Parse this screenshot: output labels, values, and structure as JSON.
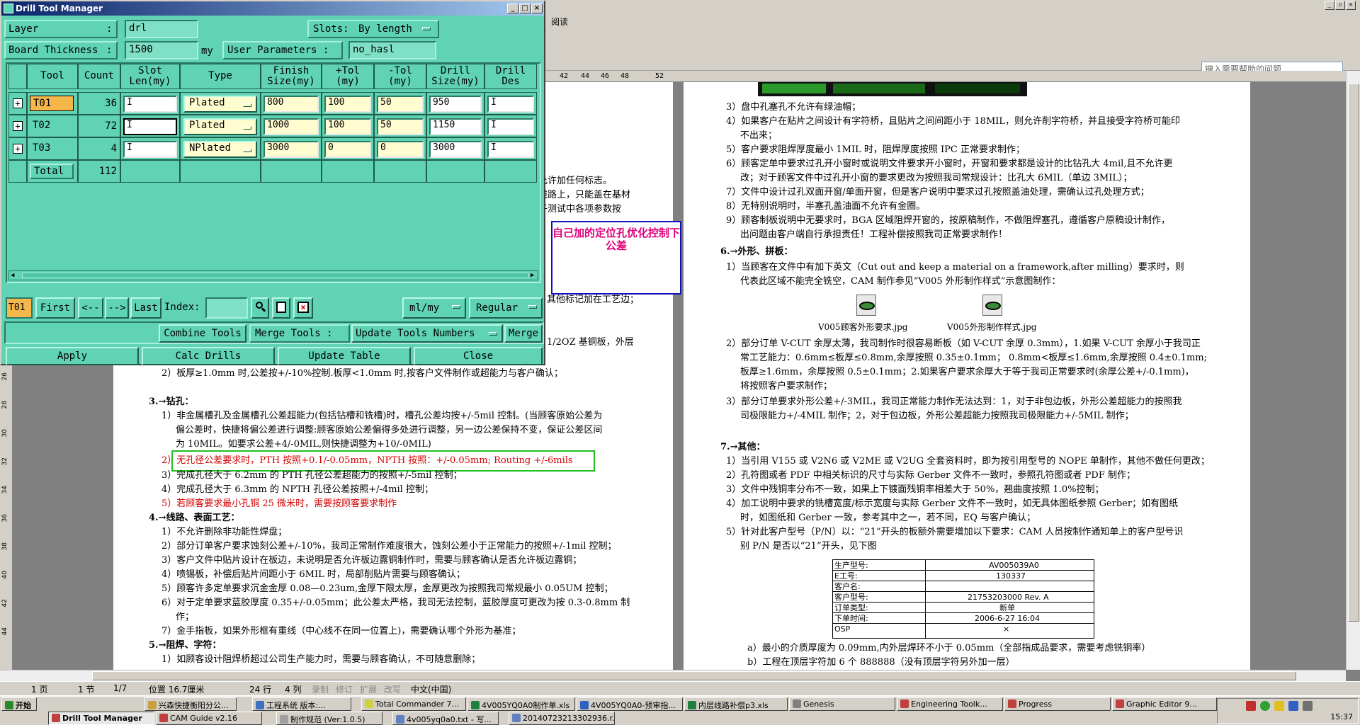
{
  "dtm": {
    "title": "Drill Tool Manager",
    "layer_label": "Layer",
    "layer_sep": ":",
    "layer_value": "drl",
    "slots_label": "Slots:",
    "slots_value": "By length",
    "board_thickness_label": "Board Thickness",
    "board_thickness_sep": ":",
    "board_thickness_value": "1500",
    "board_thickness_unit": "my",
    "user_params_label": "User Parameters :",
    "user_params_value": "no_hasl",
    "columns": [
      "Tool",
      "Count",
      "Slot Len(my)",
      "Type",
      "Finish Size(my)",
      "+Tol (my)",
      "-Tol (my)",
      "Drill Size(my)",
      "Drill Des"
    ],
    "rows": [
      {
        "tool": "T01",
        "count": "36",
        "slot_len": "",
        "type": "Plated",
        "finish": "800",
        "ptol": "100",
        "ntol": "50",
        "drill": "950",
        "des": ""
      },
      {
        "tool": "T02",
        "count": "72",
        "slot_len": "",
        "type": "Plated",
        "finish": "1000",
        "ptol": "100",
        "ntol": "50",
        "drill": "1150",
        "des": ""
      },
      {
        "tool": "T03",
        "count": "4",
        "slot_len": "",
        "type": "NPlated",
        "finish": "3000",
        "ptol": "0",
        "ntol": "0",
        "drill": "3000",
        "des": ""
      }
    ],
    "total_label": "Total",
    "total_count": "112",
    "current_tool": "T01",
    "nav": {
      "first": "First",
      "prev": "<--",
      "next": "-->",
      "last": "Last",
      "index_label": "Index:",
      "index_value": "",
      "unit": "ml/my",
      "mode": "Regular"
    },
    "actions": {
      "combine": "Combine Tools",
      "merge": "Merge Tools :",
      "update_numbers": "Update Tools Numbers",
      "merge_btn": "Merge"
    },
    "bottom": {
      "apply": "Apply",
      "calc": "Calc Drills",
      "update": "Update Table",
      "close": "Close"
    }
  },
  "annotation": "自己加的定位孔优化控制下公差",
  "word": {
    "help_placeholder": "键入需要帮助的问题",
    "toolbar_read": "阅读",
    "ruler_ticks": [
      "42",
      "44",
      "46",
      "48",
      "52"
    ],
    "left_ruler_ticks": [
      "26",
      "28",
      "30",
      "32",
      "34",
      "36",
      "38",
      "40",
      "42",
      "44"
    ],
    "status": {
      "page": "1 页",
      "section": "1 节",
      "pages": "1/7",
      "pos": "位置 16.7厘米",
      "line": "24 行",
      "col": "4 列",
      "rec": "录制",
      "trk": "修订",
      "ext": "扩展",
      "ovr": "改写",
      "lang": "中文(中国)"
    }
  },
  "left_page": [
    "允许加任何标志。",
    "线路上，只能盖在基材",
    "子测试中各项参数按",
    "其他标记加在工艺边；",
    "1/2OZ 基铜板，外层",
    "2）板厚≥1.0mm 时,公差按+/-10%控制.板厚<1.0mm 时,按客户文件制作或超能力与客户确认；",
    "3.→钻孔：",
    "1）非金属槽孔及金属槽孔公差超能力(包括钻槽和铣槽)时，槽孔公差均按+/-5mil 控制。(当顾客原始公差为",
    "偏公差时，快捷将偏公差进行调整:顾客原始公差偏得多处进行调整，另一边公差保持不变，保证公差区间",
    "为 10MIL。如要求公差+4/-0MIL,则快捷调整为+10/-0MIL)",
    "2）无孔径公差要求时，PTH 按照+0.1/-0.05mm，NPTH 按照：+/-0.05mm; Routing +/-6mils",
    "3）完成孔径大于 6.2mm 的 PTH 孔径公差超能力的按照+/-5mil 控制；",
    "4）完成孔径大于 6.3mm 的 NPTH 孔径公差按照+/-4mil 控制；",
    "5）若顾客要求最小孔铜 25 微米时，需要按顾客要求制作",
    "4.→线路、表面工艺：",
    "1）不允许删除非功能性焊盘；",
    "2）部分订单客户要求蚀刻公差+/-10%，我司正常制作难度很大，蚀刻公差小于正常能力的按照+/-1mil 控制；",
    "3）客户文件中贴片设计在板边，未说明是否允许板边露铜制作时，需要与顾客确认是否允许板边露铜；",
    "4）喷锡板，补偿后贴片间距小于 6MIL 时，局部削贴片需要与顾客确认；",
    "5）顾客许多定单要求沉金金厚 0.08—0.23um,金厚下限太厚，金厚更改为按照我司常规最小 0.05UM 控制；",
    "6）对于定单要求蓝胶厚度 0.35+/-0.05mm；此公差太严格，我司无法控制，蓝胶厚度可更改为按 0.3-0.8mm 制",
    "作；",
    "7）金手指板，如果外形框有重线（中心线不在同一位置上)，需要确认哪个外形为基准；",
    "5.→阻焊、字符：",
    "1）如顾客设计阻焊桥超过公司生产能力时，需要与顾客确认，不可随意删除；"
  ],
  "right_page": [
    "3）盘中孔塞孔不允许有绿油帽；",
    "4）如果客户在贴片之间设计有字符桥，且贴片之间间距小于 18MIL，则允许削字符桥，并且接受字符桥可能印",
    "不出来；",
    "5）客户要求阻焊厚度最小 1MIL 时，阻焊厚度按照 IPC 正常要求制作；",
    "6）顾客定单中要求过孔开小窗时或说明文件要求开小窗时，开窗和要求都是设计的比钻孔大 4mil,且不允许更",
    "改；对于顾客文件中过孔开小窗的要求更改为按照我司常规设计：比孔大 6MIL（单边 3MIL）；",
    "7）文件中设计过孔双面开窗/单面开窗，但是客户说明中要求过孔按照盖油处理，需确认过孔处理方式；",
    "8）无特别说明时，半塞孔盖油面不允许有金圈。",
    "9）顾客制板说明中无要求时，BGA 区域阻焊开窗的，按原稿制作，不做阻焊塞孔，遵循客户原稿设计制作，",
    "出问题由客户端自行承担责任！工程补偿按照我司正常要求制作！",
    "6.→外形、拼板：",
    "1）当顾客在文件中有加下英文（Cut out and keep a material on a framework,after milling）要求时，则",
    "代表此区域不能完全铣空，CAM 制作参见“V005 外形制作样式”示意图制作：",
    "V005顾客外形要求.jpg",
    "V005外形制作样式.jpg",
    "2）部分订单 V-CUT 余厚太薄，我司制作时很容易断板（如 V-CUT 余厚 0.3mm），1.如果 V-CUT 余厚小于我司正",
    "常工艺能力：0.6mm≤板厚≤0.8mm,余厚按照 0.35±0.1mm； 0.8mm<板厚≤1.6mm,余厚按照 0.4±0.1mm;",
    "板厚≥1.6mm，余厚按照 0.5±0.1mm；2.如果客户要求余厚大于等于我司正常要求时(余厚公差+/-0.1mm)，",
    "将按照客户要求制作；",
    "3）部分订单要求外形公差+/-3MIL，我司正常能力制作无法达到：1，对于非包边板，外形公差超能力的按照我",
    "司极限能力+/-4MIL 制作；2，对于包边板，外形公差超能力按照我司极限能力+/-5MIL 制作；",
    "7.→其他：",
    "1）当引用 V155 或 V2N6 或 V2ME 或 V2UG 全套资料时，即为按引用型号的 NOPE 单制作，其他不做任何更改；",
    "2）孔符图或者 PDF 中相关标识的尺寸与实际 Gerber 文件不一致时，参照孔符图或者 PDF 制作；",
    "3）文件中残铜率分布不一致，如果上下镀面残铜率相差大于 50%，翘曲度按照 1.0%控制；",
    "4）加工说明中要求的铣槽宽度/标示宽度与实际 Gerber 文件不一致时，如无具体图纸参照 Gerber；如有图纸",
    "时，如图纸和 Gerber 一致，参考其中之一，若不同，EQ 与客户确认；",
    "5）针对此客户型号（P/N）以：“21”开头的板额外需要增加以下要求：CAM 人员按制作通知单上的客户型号识",
    "别 P/N 是否以“21”开头，见下图",
    "a）最小的介质厚度为 0.09mm,内外层焊环不小于 0.05mm（全部指成品要求，需要考虑铣铜率）",
    "b）工程在顶层字符加 6 个 888888（没有顶层字符另外加一层）"
  ],
  "table_in_doc": {
    "rows": [
      [
        "生产型号:",
        "AV005039A0"
      ],
      [
        "E工号:",
        "130337"
      ],
      [
        "客户名:",
        ""
      ],
      [
        "客户型号:",
        "21753203000 Rev. A"
      ],
      [
        "订单类型:",
        "新单"
      ],
      [
        "下单时间:",
        "2006-6-27 16:04"
      ],
      [
        "OSP",
        "×"
      ]
    ]
  },
  "taskbar": {
    "start": "开始",
    "row1": [
      "兴森快捷衡阳分公...",
      "工程系统  版本:...",
      "Total Commander 7...",
      "4V005YQ0A0制作单.xls",
      "4V005YQ0A0-预审指...",
      "内层线路补偿p3.xls",
      "Genesis",
      "Engineering Toolk...",
      "Progress",
      "Graphic Editor 9..."
    ],
    "row2": [
      "Drill Tool Manager",
      "CAM Guide v2.16",
      "制作规范 (Ver:1.0.5)",
      "4v005yq0a0.txt - 写...",
      "20140723213302936.r..."
    ],
    "clock": "15:37"
  }
}
